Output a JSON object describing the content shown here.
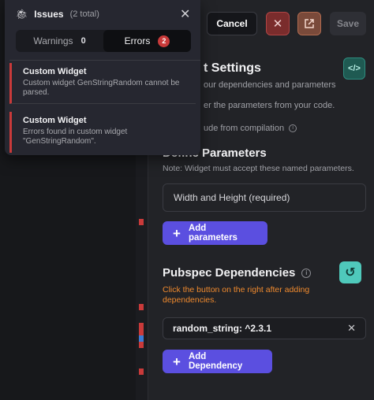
{
  "topbar": {
    "cancel_label": "Cancel",
    "close_icon": "x-icon",
    "external_icon": "external-link-icon",
    "save_label": "Save"
  },
  "settings": {
    "title": "t Settings",
    "code_icon": "</>",
    "desc1": "our dependencies and parameters",
    "desc2": "er the parameters from your code.",
    "exclude_label": "ude from compilation"
  },
  "params": {
    "title": "Define Parameters",
    "note": "Note: Widget must accept these named parameters.",
    "input_value": "Width and Height (required)",
    "add_label": "Add parameters"
  },
  "pubspec": {
    "title": "Pubspec Dependencies",
    "note": "Click the button on the right after adding dependencies.",
    "dependency": "random_string: ^2.3.1",
    "add_label": "Add Dependency"
  },
  "issues": {
    "title": "Issues",
    "count": "(2 total)",
    "tabs": [
      {
        "label": "Warnings",
        "count": "0"
      },
      {
        "label": "Errors",
        "count": "2"
      }
    ],
    "items": [
      {
        "title": "Custom Widget",
        "message": "Custom widget GenStringRandom cannot be parsed."
      },
      {
        "title": "Custom Widget",
        "message": "Errors found in custom widget \"GenStringRandom\"."
      }
    ]
  },
  "colors": {
    "accent_purple": "#5b4fe0",
    "error_red": "#c93a3a",
    "warning_orange": "#f08a2e",
    "teal": "#4fc9bb"
  }
}
